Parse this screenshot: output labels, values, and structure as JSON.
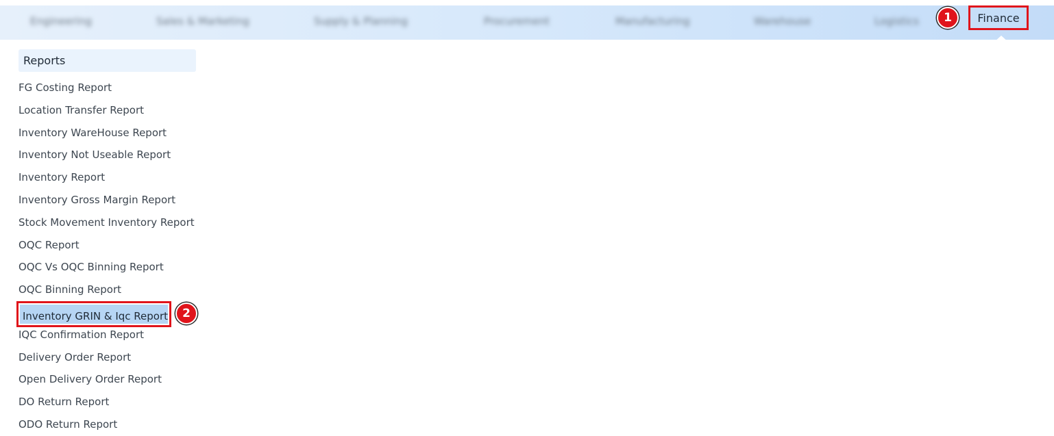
{
  "topnav": {
    "blurred_items": [
      "Engineering",
      "Sales & Marketing",
      "Supply & Planning",
      "Procurement",
      "Manufacturing",
      "Warehouse",
      "Logistics"
    ],
    "active_item": "Finance"
  },
  "annotations": {
    "step1": "1",
    "step2": "2"
  },
  "sidebar": {
    "header": "Reports",
    "items": [
      "FG Costing Report",
      "Location Transfer Report",
      "Inventory WareHouse Report",
      "Inventory Not Useable Report",
      "Inventory Report",
      "Inventory Gross Margin Report",
      "Stock Movement Inventory Report",
      "OQC Report",
      "OQC Vs OQC Binning Report",
      "OQC Binning Report",
      "Inventory GRIN & Iqc Report",
      "IQC Confirmation Report",
      "Delivery Order Report",
      "Open Delivery Order Report",
      "DO Return Report",
      "ODO Return Report"
    ],
    "selected_index": 10
  },
  "colors": {
    "highlight_red": "#e0141b",
    "selected_bg": "#b6d5f4",
    "header_bg": "#eaf3fd"
  }
}
